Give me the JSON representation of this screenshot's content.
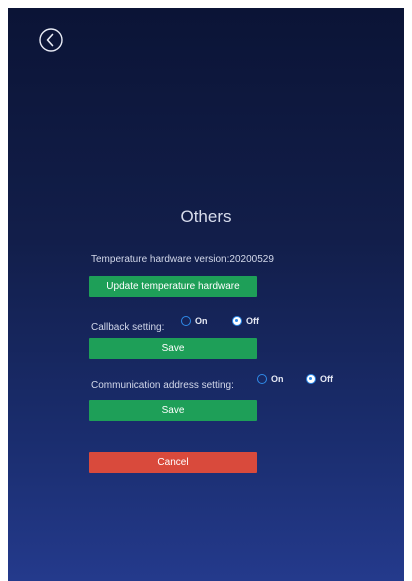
{
  "page": {
    "title": "Others"
  },
  "hardware": {
    "version_label": "Temperature hardware version:20200529",
    "update_button": "Update temperature hardware"
  },
  "callback": {
    "label": "Callback setting:",
    "options": [
      {
        "label": "On",
        "selected": false
      },
      {
        "label": "Off",
        "selected": true
      }
    ],
    "save_button": "Save"
  },
  "communication": {
    "label": "Communication address setting:",
    "options": [
      {
        "label": "On",
        "selected": false
      },
      {
        "label": "Off",
        "selected": true
      }
    ],
    "save_button": "Save"
  },
  "cancel_button": "Cancel",
  "icons": {
    "back": "back-arrow-circle-icon"
  },
  "colors": {
    "primary_button": "#1e9f58",
    "cancel_button": "#d94a3c",
    "radio_accent": "#2f8ae8"
  }
}
